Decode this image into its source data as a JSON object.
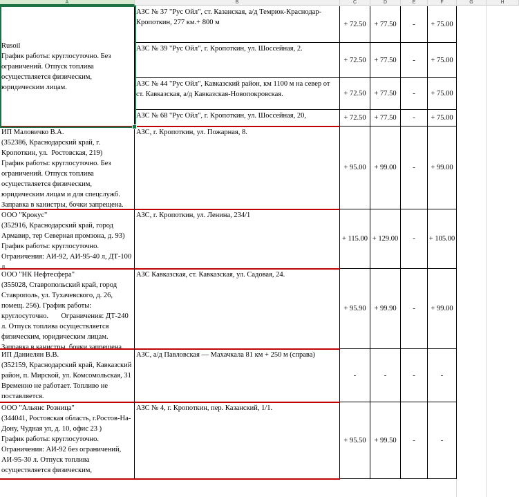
{
  "columns": [
    "A",
    "B",
    "C",
    "D",
    "E",
    "F",
    "G",
    "H"
  ],
  "rows": [
    {
      "company": "Rusoil\nГрафик работы: круглосуточно. Без ограничений. Отпуск топлива осуществляется физическим, юридическим лицам.",
      "stations": [
        {
          "address": "АЗС № 37 \"Рус Ойл\", ст. Казанская, а/д Темрюк-Краснодар-Кропоткин, 277 км.+ 800 м",
          "c": "+ 72.50",
          "d": "+ 77.50",
          "e": "-",
          "f": "+ 75.00"
        },
        {
          "address": "АЗС № 39 \"Рус Ойл\", г. Кропоткин, ул. Шоссейная, 2.",
          "c": "+ 72.50",
          "d": "+ 77.50",
          "e": "-",
          "f": "+ 75.00"
        },
        {
          "address": "АЗС № 44 \"Рус Ойл\", Кавказский район, км 1100 м на север от ст. Кавказская, а/д Кавказская-Новопокровская.",
          "c": "+ 72.50",
          "d": "+ 77.50",
          "e": "-",
          "f": "+ 75.00"
        },
        {
          "address": "АЗС № 68 \"Рус Ойл\", г. Кропоткин, ул. Шоссейная, 20,",
          "c": "+ 72.50",
          "d": "+ 77.50",
          "e": "-",
          "f": "+ 75.00"
        }
      ]
    },
    {
      "company": "ИП Маловичко В.А.\n(352386, Краснодарский край, г. Кропоткин, ул.  Ростовская, 219)\nГрафик работы: круглосуточно. Без ограничений. Отпуск топлива осуществляется физическим, юридическим лицам и для спецслужб. Заправка в канистры, бочки запрещена.",
      "stations": [
        {
          "address": "АЗС, г. Кропоткин, ул. Пожарная, 8.",
          "c": "+ 95.00",
          "d": "+ 99.00",
          "e": "-",
          "f": "+ 99.00"
        }
      ]
    },
    {
      "company": "ООО \"Крокус\"\n(352916, Краснодарский край, город Армавир, тер Северная промзона, д. 93)                 График работы: круглосуточно.       Ограничения: АИ-92, АИ-95-40 л, ДТ-100 л.",
      "stations": [
        {
          "address": "АЗС, г. Кропоткин, ул. Ленина, 234/1",
          "c": "+ 115.00",
          "d": "+ 129.00",
          "e": "-",
          "f": "+ 105.00"
        }
      ]
    },
    {
      "company": "ООО \"НК Нефтесфера\"\n(355028, Ставропольский край, город Ставрополь, ул. Тухачевского, д. 26, помещ. 256). График работы: круглосуточно.       Ограничения: ДТ-240 л. Отпуск топлива осуществляется физическим, юридическим лицам. Заправка в канистры, бочки запрещена.",
      "stations": [
        {
          "address": "АЗС Кавказская, ст. Кавказская, ул. Садовая, 24.",
          "c": "+ 95.90",
          "d": "+ 99.90",
          "e": "-",
          "f": "+ 99.00"
        }
      ]
    },
    {
      "company": "ИП Даниелян В.В.\n(352159, Краснодарский край, Кавказский район, п. Мирской, ул. Комсомольская, 31 Временно не работает. Топливо не поставляется.",
      "stations": [
        {
          "address": "АЗС, а/д Павловская — Махачкала 81 км + 250 м (справа)",
          "c": "-",
          "d": "-",
          "e": "-",
          "f": "-"
        }
      ]
    },
    {
      "company": "ООО \"Альянс Розница\"\n(344041, Ростовская область, г.Ростов-На-Дону, Чудная ул, д. 10, офис 23 )\nГрафик работы: круглосуточно. Ограничения: АИ-92 без ограничений, АИ-95-30 л. Отпуск топлива осуществляется физическим,",
      "stations": [
        {
          "address": "АЗС № 4, г. Кропоткин, пер. Казанский, 1/1.",
          "c": "+ 95.50",
          "d": "+ 99.50",
          "e": "-",
          "f": "-"
        }
      ]
    }
  ]
}
